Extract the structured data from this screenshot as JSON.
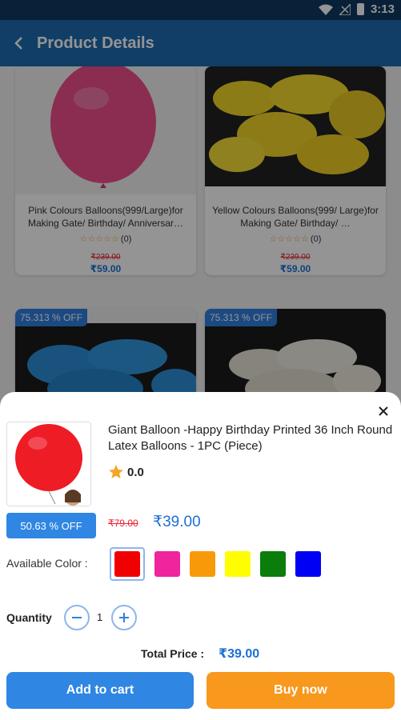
{
  "status_bar": {
    "time": "3:13"
  },
  "app_bar": {
    "title": "Product Details"
  },
  "grid": {
    "cards": [
      {
        "name": "Pink Colours Balloons(999/Large)for Making Gate/ Birthday/ Anniversar…",
        "rating_count": "(0)",
        "mrp": "₹239.00",
        "price": "₹59.00"
      },
      {
        "name": "Yellow Colours Balloons(999/ Large)for Making Gate/ Birthday/ …",
        "rating_count": "(0)",
        "mrp": "₹239.00",
        "price": "₹59.00"
      },
      {
        "badge": "75.313 % OFF"
      },
      {
        "badge": "75.313 % OFF"
      }
    ]
  },
  "sheet": {
    "name": "Giant Balloon -Happy Birthday Printed 36 Inch Round Latex Balloons - 1PC (Piece)",
    "rating": "0.0",
    "discount": "50.63 % OFF",
    "mrp": "₹79.00",
    "price": "₹39.00",
    "color_label": "Available Color :",
    "colors": [
      {
        "name": "red",
        "hex": "#f00000",
        "selected": true
      },
      {
        "name": "pink",
        "hex": "#f0249c"
      },
      {
        "name": "orange",
        "hex": "#f79a09"
      },
      {
        "name": "yellow",
        "hex": "#fefe00"
      },
      {
        "name": "green",
        "hex": "#0a7d0a"
      },
      {
        "name": "blue",
        "hex": "#0000f5"
      }
    ],
    "qty_label": "Quantity",
    "qty_value": "1",
    "total_label": "Total Price :",
    "total_value": "₹39.00",
    "add_to_cart": "Add to cart",
    "buy_now": "Buy now"
  },
  "accent_color": "#1e6bb0",
  "icons": [
    "wifi-icon",
    "signal-icon",
    "battery-icon",
    "back-arrow-icon",
    "star-icon",
    "close-icon",
    "minus-icon",
    "plus-icon"
  ]
}
